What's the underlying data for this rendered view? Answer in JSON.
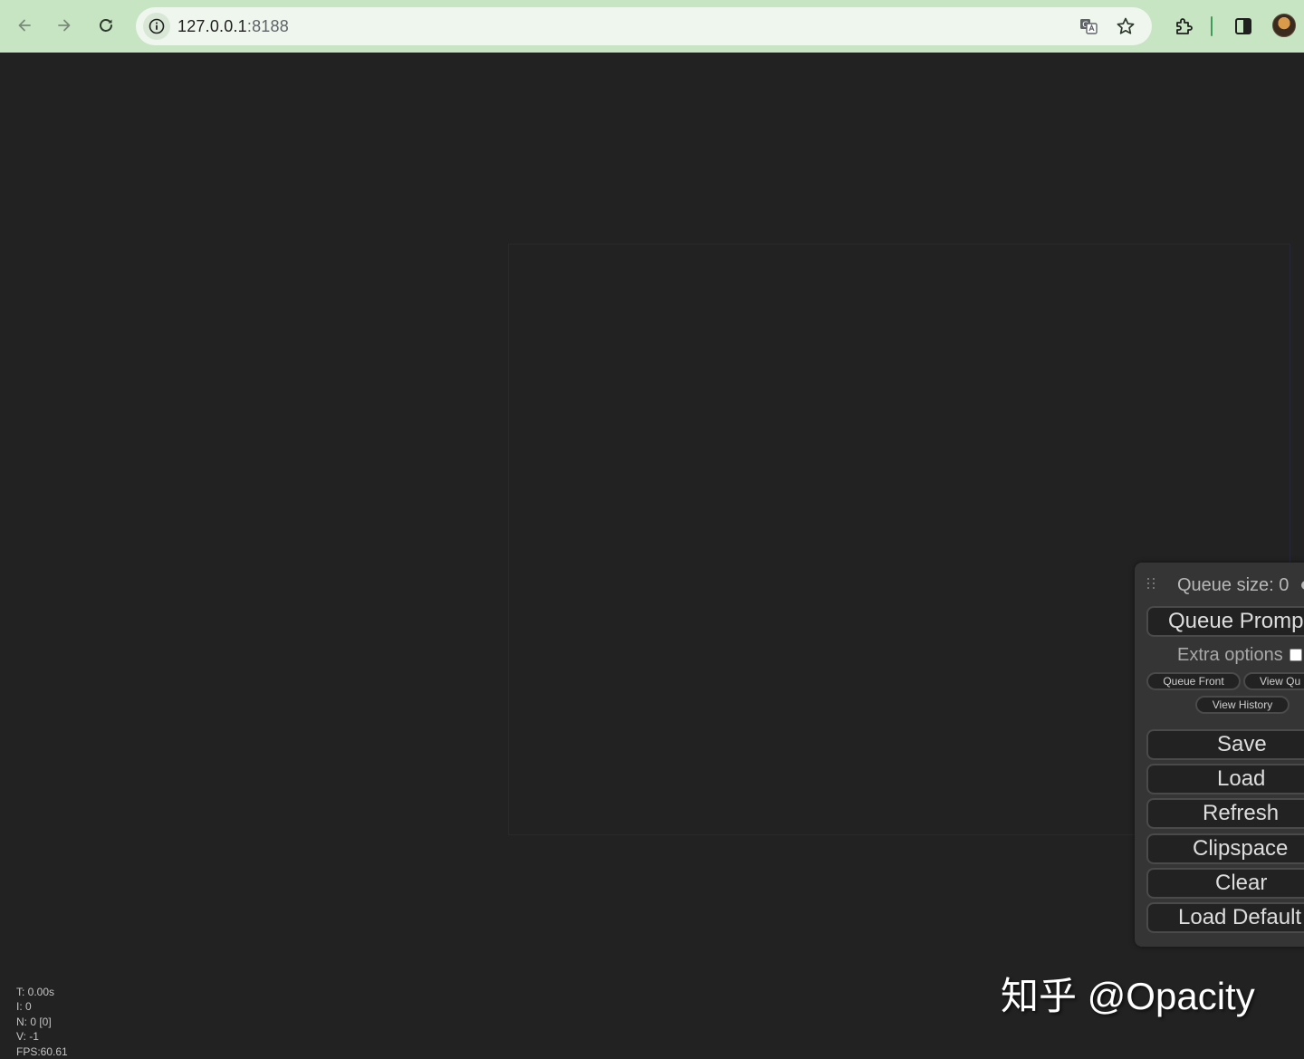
{
  "browser": {
    "url_host": "127.0.0.1",
    "url_port": ":8188"
  },
  "menu": {
    "queue_size": "Queue size: 0",
    "queue_prompt": "Queue Promp",
    "extra_options": "Extra options",
    "queue_front": "Queue Front",
    "view_queue": "View Qu",
    "view_history": "View History",
    "save": "Save",
    "load": "Load",
    "refresh": "Refresh",
    "clipspace": "Clipspace",
    "clear": "Clear",
    "load_default": "Load Default"
  },
  "stats": {
    "time": "T: 0.00s",
    "iterations": "I: 0",
    "nodes": "N: 0 [0]",
    "version": "V: -1",
    "fps": "FPS:60.61"
  },
  "watermark": "知乎 @Opacity",
  "colors": {
    "chrome_bg": "#c7e5c3",
    "canvas_bg": "#222222",
    "panel_bg": "#353535"
  }
}
